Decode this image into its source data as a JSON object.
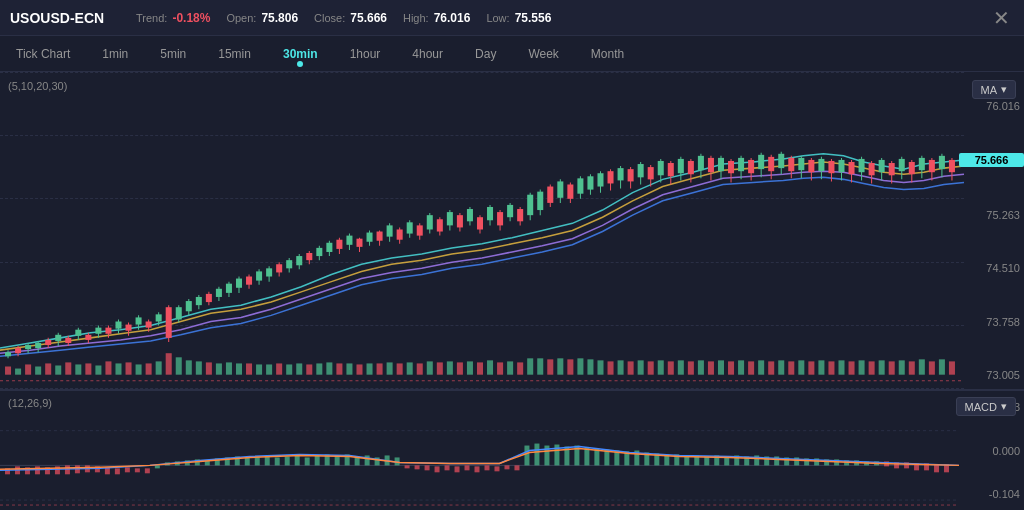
{
  "header": {
    "symbol": "USOUSD-ECN",
    "trend_label": "Trend:",
    "trend_value": "-0.18%",
    "open_label": "Open:",
    "open_value": "75.806",
    "close_label": "Close:",
    "close_value": "75.666",
    "high_label": "High:",
    "high_value": "76.016",
    "low_label": "Low:",
    "low_value": "75.556",
    "close_btn": "✕"
  },
  "timeframes": [
    {
      "id": "tick",
      "label": "Tick Chart",
      "active": false
    },
    {
      "id": "1min",
      "label": "1min",
      "active": false
    },
    {
      "id": "5min",
      "label": "5min",
      "active": false
    },
    {
      "id": "15min",
      "label": "15min",
      "active": false
    },
    {
      "id": "30min",
      "label": "30min",
      "active": true
    },
    {
      "id": "1hour",
      "label": "1hour",
      "active": false
    },
    {
      "id": "4hour",
      "label": "4hour",
      "active": false
    },
    {
      "id": "day",
      "label": "Day",
      "active": false
    },
    {
      "id": "week",
      "label": "Week",
      "active": false
    },
    {
      "id": "month",
      "label": "Month",
      "active": false
    }
  ],
  "main_chart": {
    "indicator_label": "(5,10,20,30)",
    "ma_dropdown": "MA",
    "price_levels": [
      "76.016",
      "75.666",
      "75.263",
      "74.510",
      "73.758",
      "73.005"
    ],
    "current_price": "75.666"
  },
  "macd_panel": {
    "indicator_label": "(12,26,9)",
    "macd_dropdown": "MACD",
    "price_levels": [
      "0.333",
      "0.000",
      "-0.104"
    ]
  }
}
